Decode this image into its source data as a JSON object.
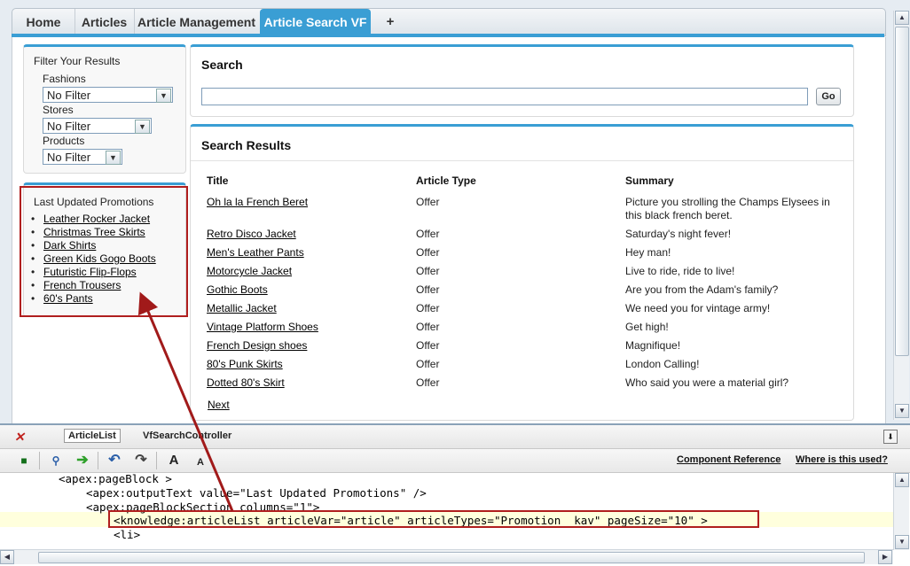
{
  "tabs": [
    {
      "label": "Home"
    },
    {
      "label": "Articles"
    },
    {
      "label": "Article Management"
    },
    {
      "label": "Article Search VF"
    },
    {
      "label": "+"
    }
  ],
  "filter": {
    "title": "Filter Your Results",
    "groups": [
      {
        "label": "Fashions",
        "value": "No Filter"
      },
      {
        "label": "Stores",
        "value": "No Filter"
      },
      {
        "label": "Products",
        "value": "No Filter"
      }
    ]
  },
  "promotions": {
    "title": "Last Updated Promotions",
    "items": [
      "Leather Rocker Jacket",
      "Christmas Tree Skirts",
      "Dark Shirts",
      "Green Kids Gogo Boots",
      "Futuristic Flip-Flops",
      "French Trousers",
      "60's Pants"
    ]
  },
  "search": {
    "title": "Search",
    "query": "",
    "go_label": "Go"
  },
  "results": {
    "title": "Search Results",
    "columns": [
      "Title",
      "Article Type",
      "Summary"
    ],
    "rows": [
      {
        "title": "Oh la la French Beret",
        "type": "Offer",
        "summary": "Picture you strolling the Champs Elysees in this black french beret."
      },
      {
        "title": "Retro Disco Jacket",
        "type": "Offer",
        "summary": "Saturday's night fever!"
      },
      {
        "title": "Men's Leather Pants",
        "type": "Offer",
        "summary": "Hey man!"
      },
      {
        "title": "Motorcycle Jacket",
        "type": "Offer",
        "summary": "Live to ride, ride to live!"
      },
      {
        "title": "Gothic Boots",
        "type": "Offer",
        "summary": "Are you from the Adam's family?"
      },
      {
        "title": "Metallic Jacket",
        "type": "Offer",
        "summary": "We need you for vintage army!"
      },
      {
        "title": "Vintage Platform Shoes",
        "type": "Offer",
        "summary": "Get high!"
      },
      {
        "title": "French Design shoes",
        "type": "Offer",
        "summary": "Magnifique!"
      },
      {
        "title": "80's Punk Skirts",
        "type": "Offer",
        "summary": "London Calling!"
      },
      {
        "title": "Dotted 80's Skirt",
        "type": "Offer",
        "summary": "Who said you were a material girl?"
      }
    ],
    "next_label": "Next"
  },
  "editor": {
    "tabs": [
      {
        "label": "ArticleList"
      },
      {
        "label": "VfSearchController"
      }
    ],
    "links": {
      "component_reference": "Component Reference",
      "where_used": "Where is this used?"
    },
    "toolbar_letters": {
      "large": "A",
      "small": "A"
    },
    "lines": [
      "<apex:pageBlock >",
      "<apex:outputText value=\"Last Updated Promotions\" />",
      "<apex:pageBlockSection columns=\"1\">",
      "<knowledge:articleList articleVar=\"article\" articleTypes=\"Promotion__kav\" pageSize=\"10\" >",
      "<li>"
    ]
  },
  "colors": {
    "accent": "#3a9ed4",
    "highlight_box": "#b01e1e",
    "arrow": "#a11a1a",
    "highlight_line": "#ffffdd"
  }
}
